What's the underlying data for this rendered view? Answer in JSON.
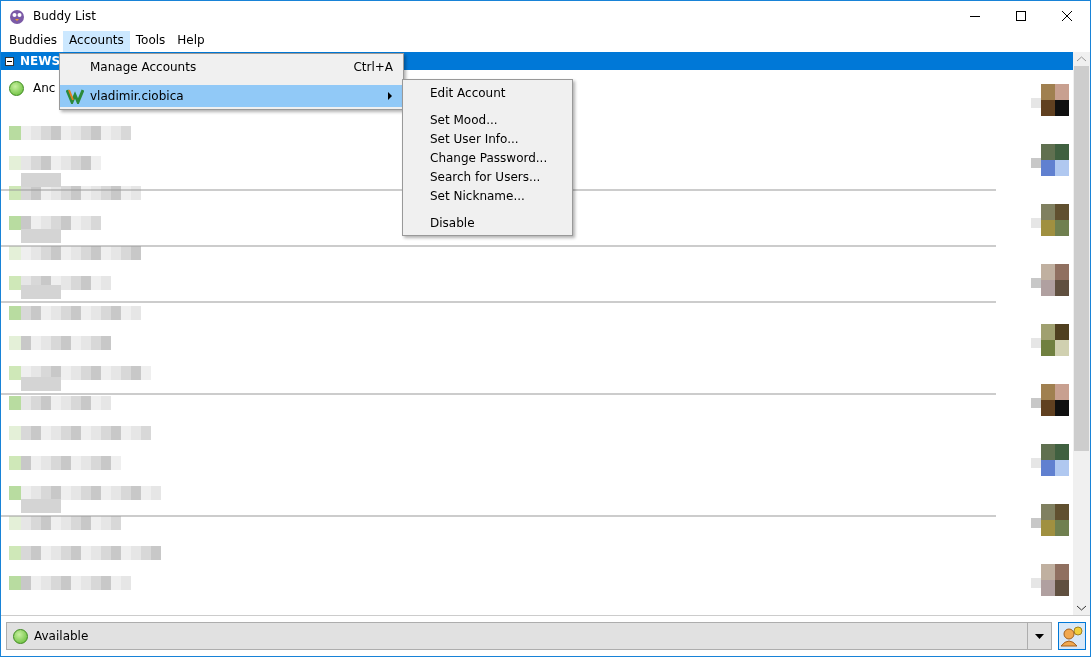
{
  "window": {
    "title": "Buddy List"
  },
  "menu_bar": [
    {
      "label": "Buddies",
      "selected": false
    },
    {
      "label": "Accounts",
      "selected": true
    },
    {
      "label": "Tools",
      "selected": false
    },
    {
      "label": "Help",
      "selected": false
    }
  ],
  "accounts_menu": [
    {
      "label": "Manage Accounts",
      "shortcut": "Ctrl+A",
      "selected": false
    },
    {
      "label": "vladimir.ciobica",
      "selected": true,
      "submenu": true
    }
  ],
  "account_submenu": [
    {
      "kind": "item",
      "label": "Edit Account"
    },
    {
      "kind": "separator"
    },
    {
      "kind": "item",
      "label": "Set Mood..."
    },
    {
      "kind": "item",
      "label": "Set User Info..."
    },
    {
      "kind": "item",
      "label": "Change Password..."
    },
    {
      "kind": "item",
      "label": "Search for Users..."
    },
    {
      "kind": "item",
      "label": "Set Nickname..."
    },
    {
      "kind": "separator"
    },
    {
      "kind": "item",
      "label": "Disable"
    }
  ],
  "group": {
    "name": "NEWS",
    "expanded": true
  },
  "buddies": [
    {
      "name": "Anc",
      "online": true
    }
  ],
  "status_selector": {
    "value": "Available",
    "online": true
  }
}
